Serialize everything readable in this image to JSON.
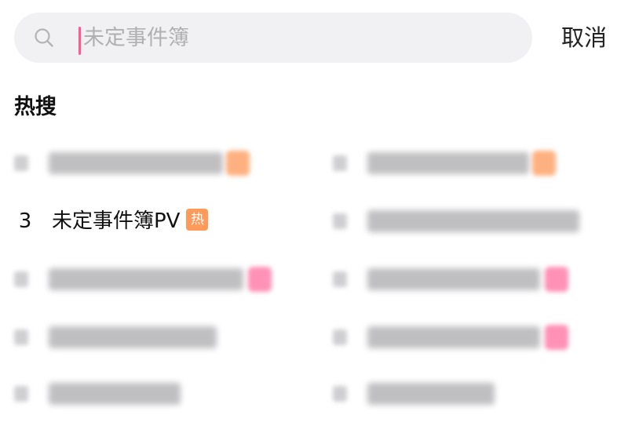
{
  "search": {
    "placeholder": "未定事件簿",
    "cancel_label": "取消"
  },
  "hot_search": {
    "title": "热搜",
    "items": [
      {
        "obscured": true,
        "badge_color": "#ffa36a"
      },
      {
        "obscured": true,
        "badge_color": "#ffa36a"
      },
      {
        "obscured": false,
        "rank": "3",
        "label": "未定事件簿PV",
        "badge": "热",
        "badge_color": "#ff9a5a"
      },
      {
        "obscured": true
      },
      {
        "obscured": true,
        "badge_color": "#ff7eaa"
      },
      {
        "obscured": true,
        "badge_color": "#ff7eaa"
      },
      {
        "obscured": true
      },
      {
        "obscured": true,
        "badge_color": "#ff7eaa"
      },
      {
        "obscured": true
      },
      {
        "obscured": true
      }
    ]
  }
}
